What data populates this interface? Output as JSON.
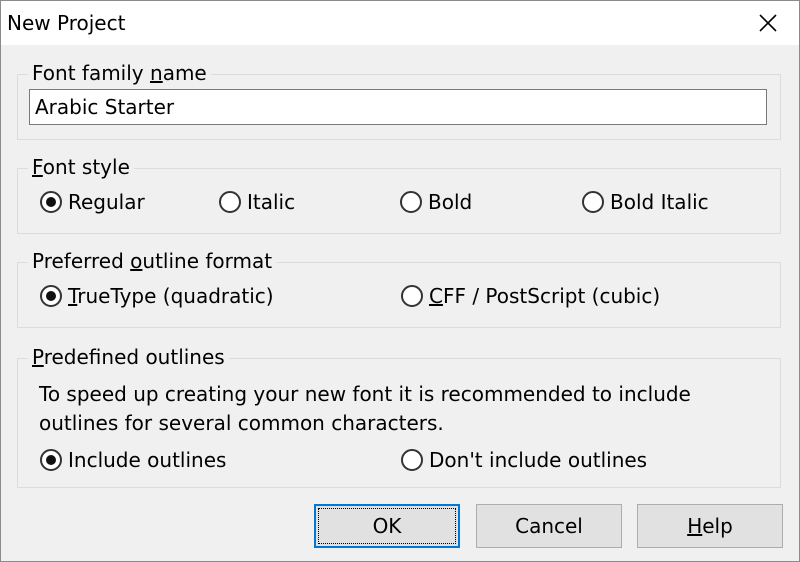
{
  "window": {
    "title": "New Project"
  },
  "font_family": {
    "legend_pre": "Font family ",
    "legend_u": "n",
    "legend_post": "ame",
    "value": "Arabic Starter"
  },
  "font_style": {
    "legend_u": "F",
    "legend_post": "ont style",
    "options": [
      {
        "label": "Regular",
        "checked": true
      },
      {
        "label": "Italic",
        "checked": false
      },
      {
        "label": "Bold",
        "checked": false
      },
      {
        "label": "Bold Italic",
        "checked": false
      }
    ]
  },
  "outline_format": {
    "legend_pre": "Preferred ",
    "legend_u": "o",
    "legend_post": "utline format",
    "options": [
      {
        "u": "T",
        "rest": "rueType (quadratic)",
        "checked": true
      },
      {
        "u": "C",
        "rest": "FF / PostScript (cubic)",
        "checked": false
      }
    ]
  },
  "predefined": {
    "legend_u": "P",
    "legend_post": "redefined outlines",
    "description_line1": "To speed up creating your new font it is recommended to include",
    "description_line2": "outlines for several common characters.",
    "options": [
      {
        "label": "Include outlines",
        "checked": true
      },
      {
        "label": "Don't include outlines",
        "checked": false
      }
    ]
  },
  "buttons": {
    "ok": "OK",
    "cancel": "Cancel",
    "help_u": "H",
    "help_rest": "elp"
  }
}
